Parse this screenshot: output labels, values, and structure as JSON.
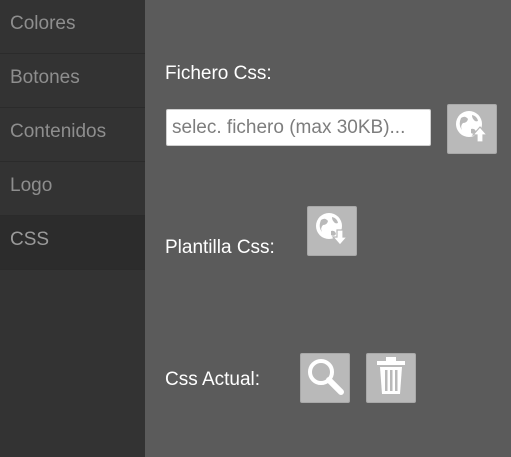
{
  "sidebar": {
    "items": [
      {
        "label": "Colores"
      },
      {
        "label": "Botones"
      },
      {
        "label": "Contenidos"
      },
      {
        "label": "Logo"
      },
      {
        "label": "CSS"
      }
    ],
    "active_index": 4
  },
  "main": {
    "file_label": "Fichero Css:",
    "file_placeholder": "selec. fichero (max 30KB)...",
    "template_label": "Plantilla Css:",
    "current_label": "Css Actual:"
  },
  "icons": {
    "upload": "globe-upload-icon",
    "download": "globe-download-icon",
    "view": "search-icon",
    "delete": "trash-icon"
  },
  "colors": {
    "sidebar_bg": "#333333",
    "main_bg": "#5b5b5b",
    "button_bg": "#b9b9b9"
  }
}
